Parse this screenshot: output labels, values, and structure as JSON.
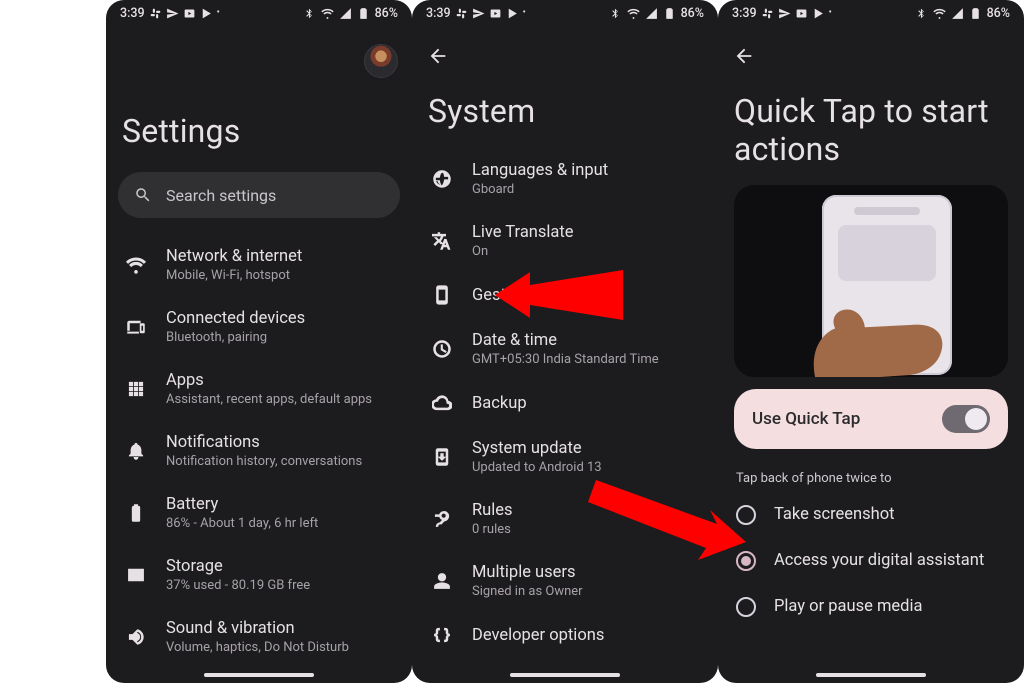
{
  "status": {
    "time": "3:39",
    "battery": "86%"
  },
  "screen1": {
    "title": "Settings",
    "search_placeholder": "Search settings",
    "items": [
      {
        "name": "network",
        "title": "Network & internet",
        "sub": "Mobile, Wi-Fi, hotspot",
        "icon": "wifi-icon"
      },
      {
        "name": "connected",
        "title": "Connected devices",
        "sub": "Bluetooth, pairing",
        "icon": "devices-icon"
      },
      {
        "name": "apps",
        "title": "Apps",
        "sub": "Assistant, recent apps, default apps",
        "icon": "apps-icon"
      },
      {
        "name": "notifications",
        "title": "Notifications",
        "sub": "Notification history, conversations",
        "icon": "bell-icon"
      },
      {
        "name": "battery",
        "title": "Battery",
        "sub": "86% - About 1 day, 6 hr left",
        "icon": "battery-icon"
      },
      {
        "name": "storage",
        "title": "Storage",
        "sub": "37% used - 80.19 GB free",
        "icon": "storage-icon"
      },
      {
        "name": "sound",
        "title": "Sound & vibration",
        "sub": "Volume, haptics, Do Not Disturb",
        "icon": "sound-icon"
      }
    ]
  },
  "screen2": {
    "title": "System",
    "items": [
      {
        "name": "languages",
        "title": "Languages & input",
        "sub": "Gboard",
        "icon": "globe-icon"
      },
      {
        "name": "translate",
        "title": "Live Translate",
        "sub": "On",
        "icon": "translate-icon"
      },
      {
        "name": "gestures",
        "title": "Gestures",
        "sub": "",
        "icon": "phone-icon"
      },
      {
        "name": "datetime",
        "title": "Date & time",
        "sub": "GMT+05:30 India Standard Time",
        "icon": "clock-icon"
      },
      {
        "name": "backup",
        "title": "Backup",
        "sub": "",
        "icon": "cloud-icon"
      },
      {
        "name": "update",
        "title": "System update",
        "sub": "Updated to Android 13",
        "icon": "update-icon"
      },
      {
        "name": "rules",
        "title": "Rules",
        "sub": "0 rules",
        "icon": "rules-icon"
      },
      {
        "name": "users",
        "title": "Multiple users",
        "sub": "Signed in as Owner",
        "icon": "user-icon"
      },
      {
        "name": "devopts",
        "title": "Developer options",
        "sub": "",
        "icon": "braces-icon"
      }
    ]
  },
  "screen3": {
    "title": "Quick Tap to start actions",
    "toggle_label": "Use Quick Tap",
    "toggle_on": true,
    "section_header": "Tap back of phone twice to",
    "options": [
      {
        "name": "screenshot",
        "label": "Take screenshot",
        "selected": false
      },
      {
        "name": "assistant",
        "label": "Access your digital assistant",
        "selected": true
      },
      {
        "name": "media",
        "label": "Play or pause media",
        "selected": false
      }
    ]
  }
}
